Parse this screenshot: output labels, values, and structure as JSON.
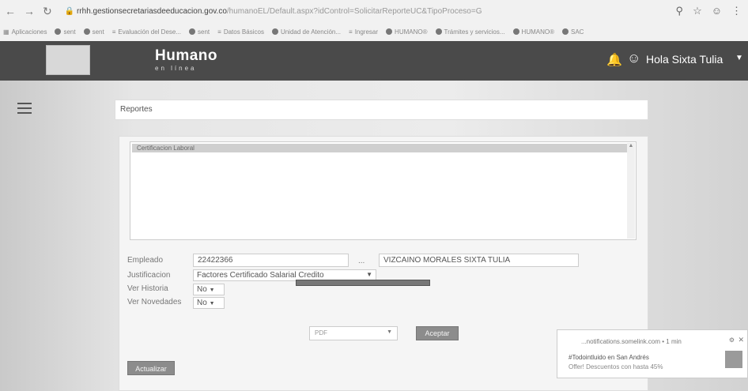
{
  "browser": {
    "url_host": "rrhh.gestionsecretariasdeeducacion.gov.co",
    "url_path": "/humanoEL/Default.aspx?idControl=SolicitarReporteUC&TipoProceso=G",
    "bookmarks": [
      "Aplicaciones",
      "sent",
      "sent",
      "Evaluación del Dese...",
      "sent",
      "Datos Básicos",
      "Unidad de Atención...",
      "Ingresar",
      "HUMANO®",
      "Trámites y servicios...",
      "HUMANO®",
      "SAC"
    ]
  },
  "header": {
    "brand": "Humano",
    "brand_sub": "en línea",
    "user_greeting": "Hola Sixta Tulia"
  },
  "page": {
    "title": "Reportes"
  },
  "report_list": {
    "selected_item": "Certificacion Laboral"
  },
  "form": {
    "empleado_label": "Empleado",
    "empleado_id": "22422366",
    "lookup_label": "...",
    "empleado_name": "VIZCAINO MORALES SIXTA TULIA",
    "justificacion_label": "Justificacion",
    "justificacion_value": "Factores Certificado Salarial Credito",
    "ver_historia_label": "Ver Historia",
    "ver_historia_value": "No",
    "ver_novedades_label": "Ver Novedades",
    "ver_novedades_value": "No"
  },
  "actions": {
    "format_value": "PDF",
    "aceptar_label": "Aceptar",
    "actualizar_label": "Actualizar"
  },
  "notification": {
    "source": "...notifications.somelink.com • 1 min",
    "line1": "#Todointluido en San Andrés",
    "line2": "Offer! Descuentos con hasta 45%"
  }
}
